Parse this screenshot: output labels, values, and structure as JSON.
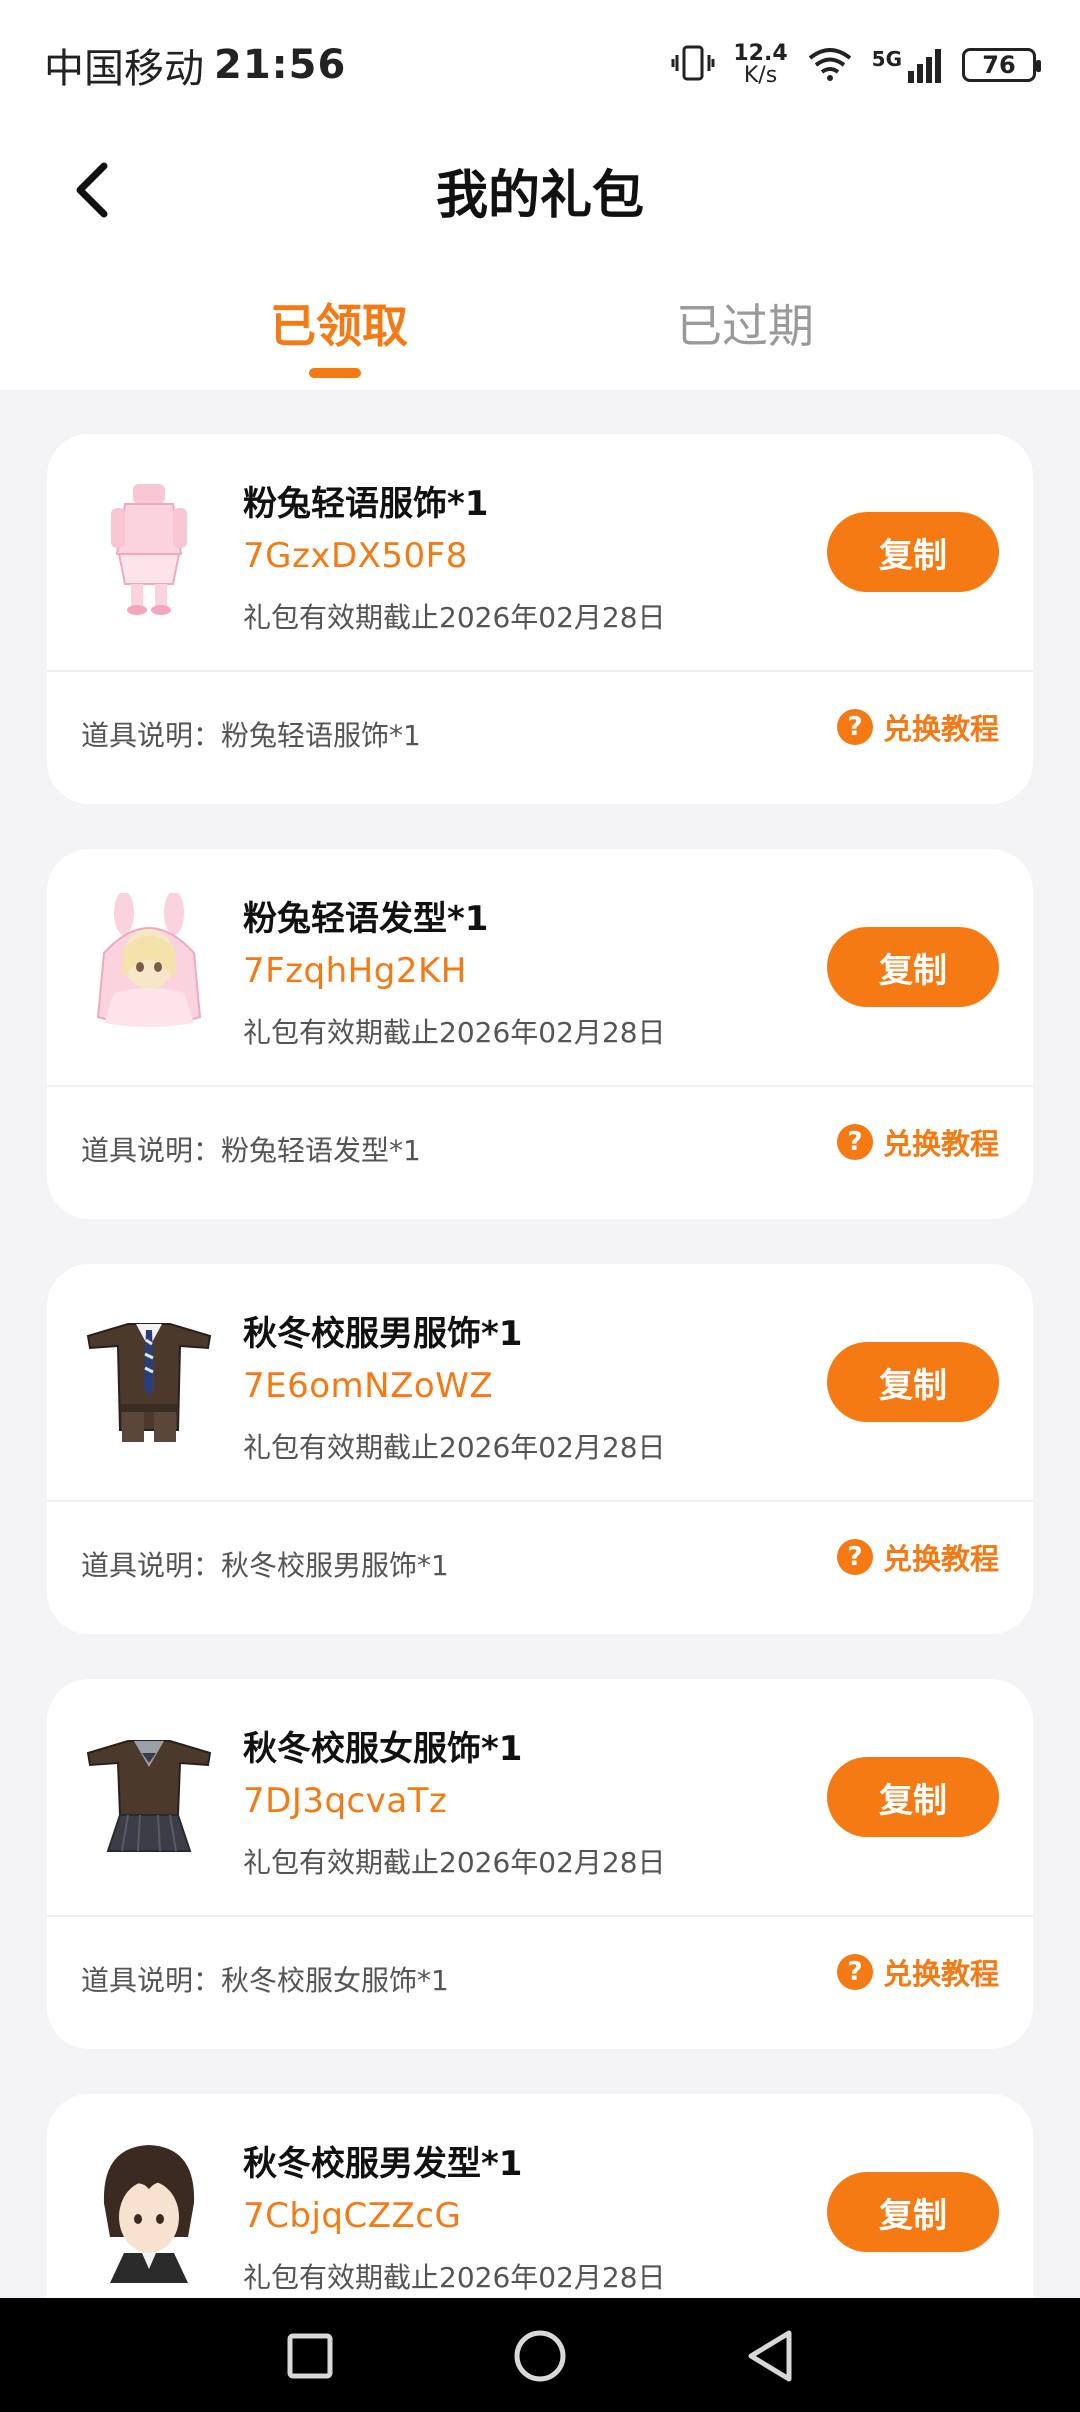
{
  "status_bar": {
    "carrier": "中国移动",
    "time": "21:56",
    "net_speed_value": "12.4",
    "net_speed_unit": "K/s",
    "network": "5G",
    "battery": "76"
  },
  "header": {
    "title": "我的礼包"
  },
  "tabs": [
    {
      "label": "已领取",
      "active": true
    },
    {
      "label": "已过期",
      "active": false
    }
  ],
  "cards": [
    {
      "name": "粉兔轻语服饰*1",
      "code": "7GzxDX50F8",
      "expiry": "礼包有效期截止2026年02月28日",
      "copy_label": "复制",
      "desc": "道具说明：粉兔轻语服饰*1",
      "tutorial_label": "兑换教程",
      "thumb_icon": "pink-bunny-outfit-icon"
    },
    {
      "name": "粉兔轻语发型*1",
      "code": "7FzqhHg2KH",
      "expiry": "礼包有效期截止2026年02月28日",
      "copy_label": "复制",
      "desc": "道具说明：粉兔轻语发型*1",
      "tutorial_label": "兑换教程",
      "thumb_icon": "pink-bunny-hairstyle-icon"
    },
    {
      "name": "秋冬校服男服饰*1",
      "code": "7E6omNZoWZ",
      "expiry": "礼包有效期截止2026年02月28日",
      "copy_label": "复制",
      "desc": "道具说明：秋冬校服男服饰*1",
      "tutorial_label": "兑换教程",
      "thumb_icon": "male-uniform-icon"
    },
    {
      "name": "秋冬校服女服饰*1",
      "code": "7DJ3qcvaTz",
      "expiry": "礼包有效期截止2026年02月28日",
      "copy_label": "复制",
      "desc": "道具说明：秋冬校服女服饰*1",
      "tutorial_label": "兑换教程",
      "thumb_icon": "female-uniform-icon"
    },
    {
      "name": "秋冬校服男发型*1",
      "code": "7CbjqCZZcG",
      "expiry": "礼包有效期截止2026年02月28日",
      "copy_label": "复制",
      "thumb_icon": "male-hairstyle-icon"
    }
  ],
  "colors": {
    "accent": "#f57a14",
    "background": "#f4f4f6"
  }
}
